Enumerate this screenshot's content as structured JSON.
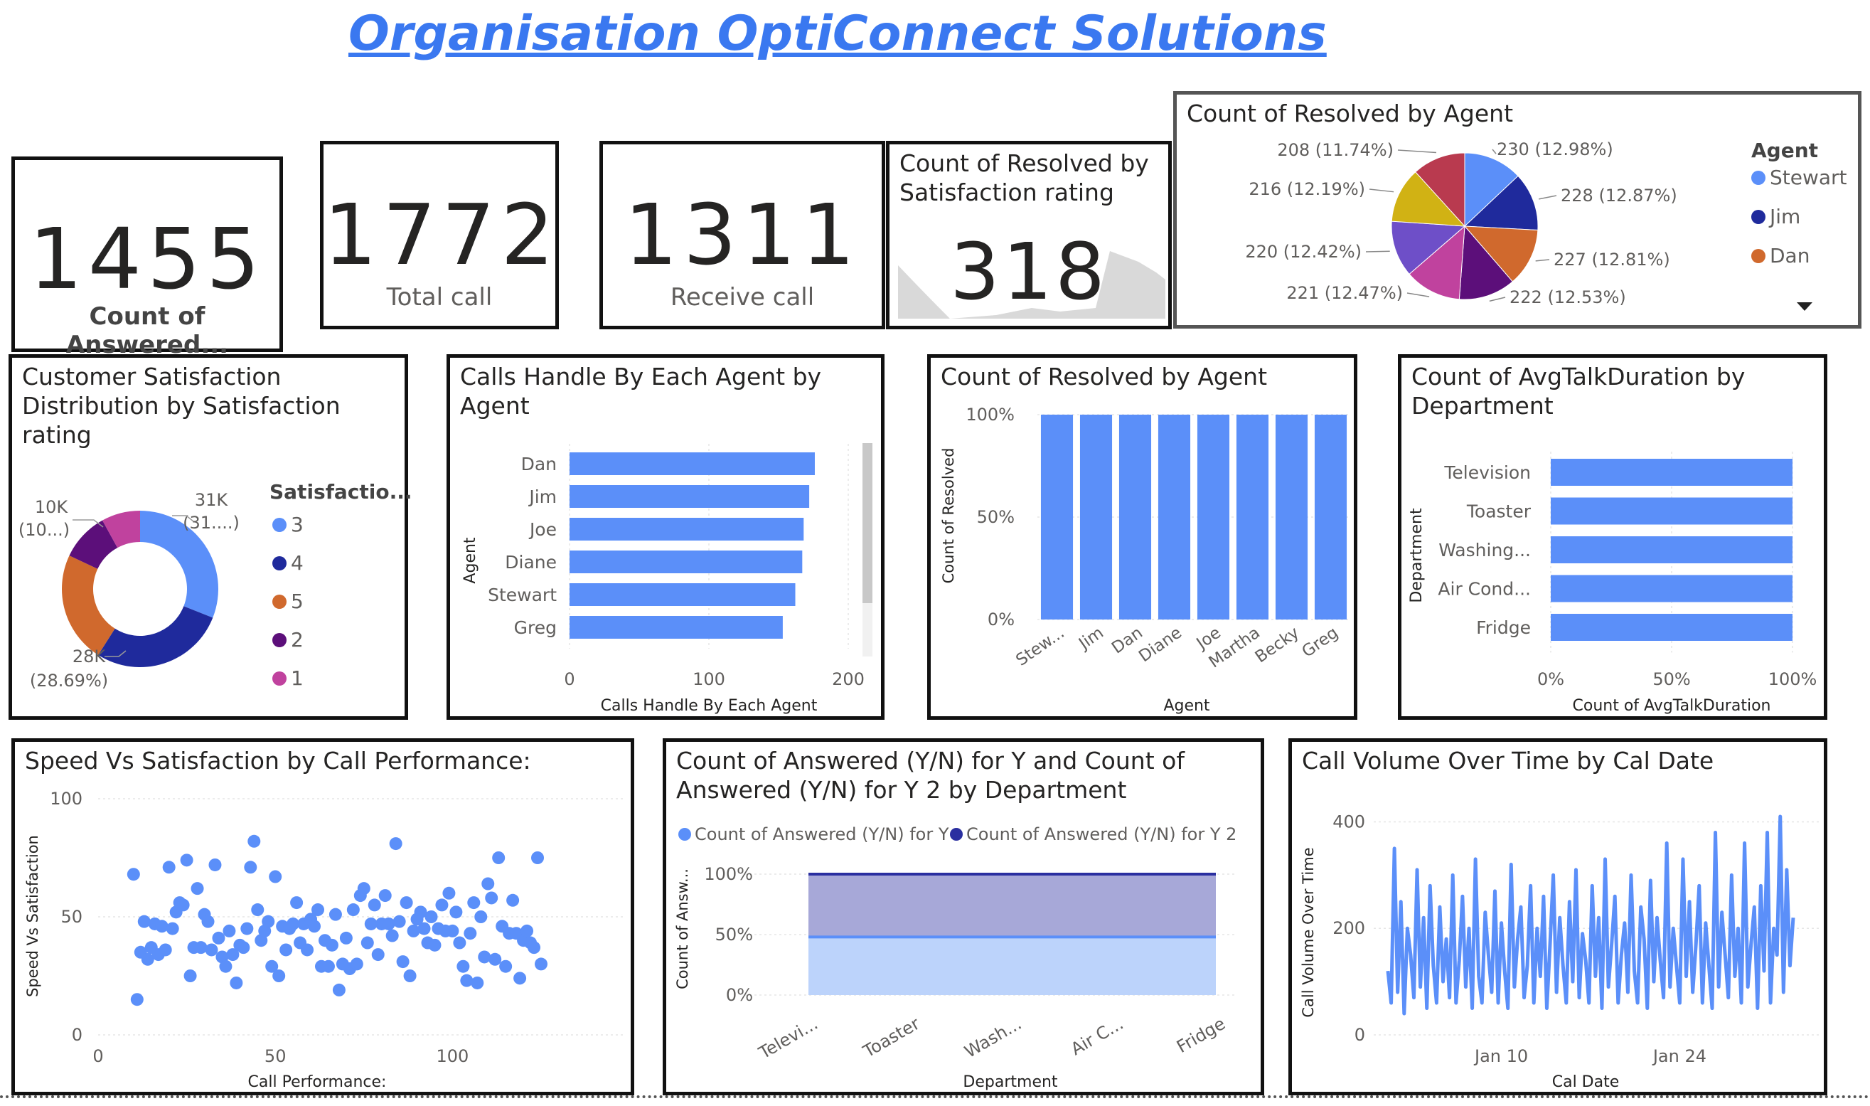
{
  "page": {
    "title": "Organisation OptiConnect Solutions"
  },
  "colors": {
    "accent": "#5b8ff9",
    "dark": "#2a2fa0"
  },
  "kpis": [
    {
      "value": "1455",
      "label": "Count of Answered..."
    },
    {
      "value": "1772",
      "label": "Total call"
    },
    {
      "value": "1311",
      "label": "Receive call"
    }
  ],
  "resolved_card": {
    "title": "Count of Resolved by Satisfaction rating",
    "value": "318"
  },
  "chart_data": [
    {
      "type": "pie",
      "title": "Count of Resolved by Agent",
      "legend_title": "Agent",
      "legend": [
        "Stewart",
        "Jim",
        "Dan"
      ],
      "slices": [
        {
          "label": "230 (12.98%)",
          "value": 230,
          "color": "#5b8ff9"
        },
        {
          "label": "228 (12.87%)",
          "value": 228,
          "color": "#1f2a9c"
        },
        {
          "label": "227 (12.81%)",
          "value": 227,
          "color": "#d0692d"
        },
        {
          "label": "222 (12.53%)",
          "value": 222,
          "color": "#5c0f7a"
        },
        {
          "label": "221 (12.47%)",
          "value": 221,
          "color": "#c0429e"
        },
        {
          "label": "220 (12.42%)",
          "value": 220,
          "color": "#6e4fc8"
        },
        {
          "label": "216 (12.19%)",
          "value": 216,
          "color": "#d1b214"
        },
        {
          "label": "208 (11.74%)",
          "value": 208,
          "color": "#b93a4f"
        }
      ]
    },
    {
      "type": "pie",
      "title": "Customer Satisfaction Distribution by Satisfaction rating",
      "legend_title": "Satisfactio...",
      "legend": [
        "3",
        "4",
        "5",
        "2",
        "1"
      ],
      "slices": [
        {
          "label": "3",
          "value": 31,
          "color": "#5b8ff9"
        },
        {
          "label": "4",
          "value": 28,
          "color": "#1f2a9c"
        },
        {
          "label": "5",
          "value": 23,
          "color": "#d0692d"
        },
        {
          "label": "2",
          "value": 10,
          "color": "#5c0f7a"
        },
        {
          "label": "1",
          "value": 8,
          "color": "#c0429e"
        }
      ],
      "annotations": [
        {
          "line1": "31K",
          "line2": "(31....)"
        },
        {
          "line1": "28K",
          "line2": "(28.69%)"
        },
        {
          "line1": "10K",
          "line2": "(10...)"
        }
      ]
    },
    {
      "type": "bar",
      "title": "Calls Handle By Each Agent by Agent",
      "ylabel": "Agent",
      "xlabel": "Calls Handle By Each Agent",
      "categories": [
        "Dan",
        "Jim",
        "Joe",
        "Diane",
        "Stewart",
        "Greg"
      ],
      "values": [
        176,
        172,
        168,
        167,
        162,
        153
      ],
      "xlim": [
        0,
        200
      ],
      "xticks": [
        "0",
        "100",
        "200"
      ]
    },
    {
      "type": "bar",
      "title": "Count of Resolved by Agent",
      "ylabel": "Count of Resolved",
      "xlabel": "Agent",
      "categories": [
        "Stew...",
        "Jim",
        "Dan",
        "Diane",
        "Joe",
        "Martha",
        "Becky",
        "Greg"
      ],
      "values": [
        100,
        100,
        100,
        100,
        100,
        100,
        100,
        100
      ],
      "ylim": [
        0,
        100
      ],
      "yticks": [
        "100%",
        "50%",
        "0%"
      ]
    },
    {
      "type": "bar",
      "title": "Count of AvgTalkDuration by Department",
      "ylabel": "Department",
      "xlabel": "Count of AvgTalkDuration",
      "categories": [
        "Television",
        "Toaster",
        "Washing...",
        "Air Cond...",
        "Fridge"
      ],
      "values": [
        100,
        100,
        100,
        100,
        100
      ],
      "xlim": [
        0,
        100
      ],
      "xticks": [
        "0%",
        "50%",
        "100%"
      ]
    },
    {
      "type": "scatter",
      "title": "Speed Vs Satisfaction by Call Performance:",
      "xlabel": "Call Performance:",
      "ylabel": "Speed Vs Satisfaction",
      "xlim": [
        0,
        125
      ],
      "ylim": [
        0,
        100
      ],
      "xticks": [
        "0",
        "50",
        "100"
      ],
      "yticks": [
        "100",
        "50",
        "0"
      ],
      "points": [
        [
          10,
          68
        ],
        [
          11,
          15
        ],
        [
          12,
          35
        ],
        [
          13,
          48
        ],
        [
          14,
          32
        ],
        [
          15,
          37
        ],
        [
          16,
          47
        ],
        [
          17,
          34
        ],
        [
          18,
          46
        ],
        [
          19,
          36
        ],
        [
          20,
          71
        ],
        [
          21,
          45
        ],
        [
          22,
          52
        ],
        [
          23,
          56
        ],
        [
          24,
          55
        ],
        [
          25,
          74
        ],
        [
          26,
          25
        ],
        [
          27,
          37
        ],
        [
          28,
          62
        ],
        [
          29,
          37
        ],
        [
          30,
          51
        ],
        [
          31,
          48
        ],
        [
          32,
          36
        ],
        [
          33,
          72
        ],
        [
          34,
          41
        ],
        [
          35,
          33
        ],
        [
          36,
          29
        ],
        [
          37,
          44
        ],
        [
          38,
          34
        ],
        [
          39,
          22
        ],
        [
          40,
          38
        ],
        [
          41,
          37
        ],
        [
          42,
          45
        ],
        [
          43,
          71
        ],
        [
          44,
          82
        ],
        [
          45,
          53
        ],
        [
          46,
          40
        ],
        [
          47,
          44
        ],
        [
          48,
          48
        ],
        [
          49,
          29
        ],
        [
          50,
          67
        ],
        [
          51,
          25
        ],
        [
          52,
          46
        ],
        [
          53,
          36
        ],
        [
          54,
          45
        ],
        [
          55,
          47
        ],
        [
          56,
          56
        ],
        [
          57,
          39
        ],
        [
          58,
          47
        ],
        [
          59,
          36
        ],
        [
          60,
          49
        ],
        [
          61,
          46
        ],
        [
          62,
          53
        ],
        [
          63,
          29
        ],
        [
          64,
          40
        ],
        [
          65,
          29
        ],
        [
          66,
          38
        ],
        [
          67,
          51
        ],
        [
          68,
          19
        ],
        [
          69,
          30
        ],
        [
          70,
          41
        ],
        [
          71,
          28
        ],
        [
          72,
          53
        ],
        [
          73,
          30
        ],
        [
          74,
          59
        ],
        [
          75,
          62
        ],
        [
          76,
          39
        ],
        [
          77,
          47
        ],
        [
          78,
          55
        ],
        [
          79,
          34
        ],
        [
          80,
          47
        ],
        [
          81,
          59
        ],
        [
          82,
          47
        ],
        [
          83,
          42
        ],
        [
          84,
          81
        ],
        [
          85,
          48
        ],
        [
          86,
          31
        ],
        [
          87,
          56
        ],
        [
          88,
          25
        ],
        [
          89,
          44
        ],
        [
          90,
          49
        ],
        [
          91,
          52
        ],
        [
          92,
          45
        ],
        [
          93,
          39
        ],
        [
          94,
          50
        ],
        [
          95,
          38
        ],
        [
          96,
          45
        ],
        [
          97,
          55
        ],
        [
          98,
          44
        ],
        [
          99,
          60
        ],
        [
          100,
          44
        ],
        [
          101,
          52
        ],
        [
          102,
          39
        ],
        [
          103,
          29
        ],
        [
          104,
          23
        ],
        [
          105,
          43
        ],
        [
          106,
          56
        ],
        [
          107,
          22
        ],
        [
          108,
          50
        ],
        [
          109,
          33
        ],
        [
          110,
          64
        ],
        [
          111,
          58
        ],
        [
          112,
          32
        ],
        [
          113,
          75
        ],
        [
          114,
          46
        ],
        [
          115,
          29
        ],
        [
          116,
          43
        ],
        [
          117,
          57
        ],
        [
          118,
          43
        ],
        [
          119,
          24
        ],
        [
          120,
          40
        ],
        [
          121,
          44
        ],
        [
          122,
          39
        ],
        [
          123,
          37
        ],
        [
          124,
          75
        ],
        [
          125,
          30
        ]
      ]
    },
    {
      "type": "area",
      "title": "Count of Answered (Y/N) for Y and Count of Answered (Y/N) for Y 2 by Department",
      "xlabel": "Department",
      "ylabel": "Count of Answ...",
      "categories": [
        "Televi...",
        "Toaster",
        "Wash...",
        "Air C...",
        "Fridge"
      ],
      "ylim": [
        0,
        100
      ],
      "yticks": [
        "100%",
        "50%",
        "0%"
      ],
      "series": [
        {
          "name": "Count of Answered (Y/N) for Y",
          "values": [
            48,
            48,
            48,
            48,
            48
          ],
          "color": "#5b8ff9"
        },
        {
          "name": "Count of Answered (Y/N) for Y 2",
          "values": [
            100,
            100,
            100,
            100,
            100
          ],
          "color": "#2a2fa0"
        }
      ]
    },
    {
      "type": "line",
      "title": "Call Volume Over Time by Cal Date",
      "xlabel": "Cal Date",
      "ylabel": "Call Volume Over Time",
      "ylim": [
        0,
        430
      ],
      "yticks": [
        "400",
        "200",
        "0"
      ],
      "xticks": [
        {
          "label": "Jan 10",
          "pos": 0.28
        },
        {
          "label": "Jan 24",
          "pos": 0.72
        }
      ],
      "values": [
        120,
        60,
        350,
        80,
        250,
        40,
        200,
        150,
        70,
        310,
        90,
        220,
        50,
        280,
        130,
        60,
        240,
        100,
        180,
        70,
        300,
        60,
        140,
        260,
        90,
        200,
        50,
        330,
        110,
        60,
        230,
        150,
        80,
        270,
        60,
        210,
        120,
        50,
        320,
        90,
        180,
        240,
        70,
        130,
        280,
        60,
        200,
        110,
        260,
        50,
        170,
        300,
        80,
        220,
        130,
        60,
        250,
        100,
        310,
        70,
        190,
        140,
        60,
        280,
        110,
        220,
        50,
        330,
        90,
        170,
        260,
        60,
        150,
        210,
        80,
        300,
        120,
        60,
        240,
        180,
        50,
        290,
        100,
        220,
        140,
        70,
        360,
        90,
        200,
        130,
        60,
        330,
        110,
        250,
        80,
        170,
        280,
        60,
        210,
        130,
        50,
        380,
        90,
        230,
        150,
        70,
        300,
        110,
        200,
        60,
        360,
        90,
        170,
        240,
        50,
        280,
        120,
        380,
        60,
        200,
        150,
        410,
        80,
        310,
        130,
        220
      ]
    }
  ]
}
